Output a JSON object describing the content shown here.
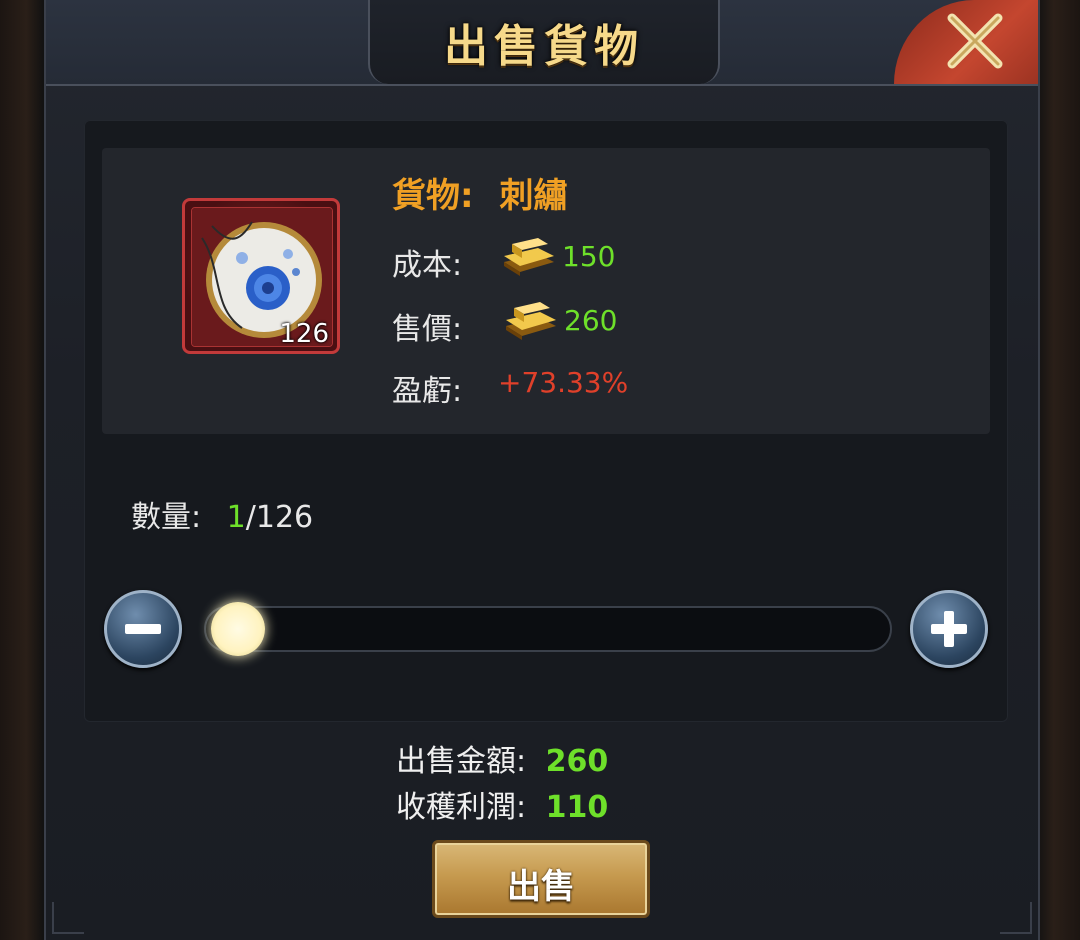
{
  "dialog": {
    "title": "出售貨物",
    "close_icon": "close-x-icon"
  },
  "item": {
    "goods_label": "貨物:",
    "goods_name": "刺繡",
    "icon": "embroidery-hoop-icon",
    "count": "126",
    "cost_label": "成本:",
    "cost_value": "150",
    "price_label": "售價:",
    "price_value": "260",
    "profit_label": "盈虧:",
    "profit_value": "+73.33%",
    "currency_icon": "gold-ingot-icon"
  },
  "quantity": {
    "label": "數量:",
    "current": "1",
    "max": "/126",
    "slider_fraction": 0.0079
  },
  "summary": {
    "sale_amount_label": "出售金額:",
    "sale_amount_value": "260",
    "profit_label": "收穫利潤:",
    "profit_value": "110"
  },
  "sell_button": "出售",
  "colors": {
    "accent_orange": "#f0a024",
    "value_green": "#6ee02a",
    "profit_red": "#e0402a",
    "close_red": "#c4462f"
  }
}
